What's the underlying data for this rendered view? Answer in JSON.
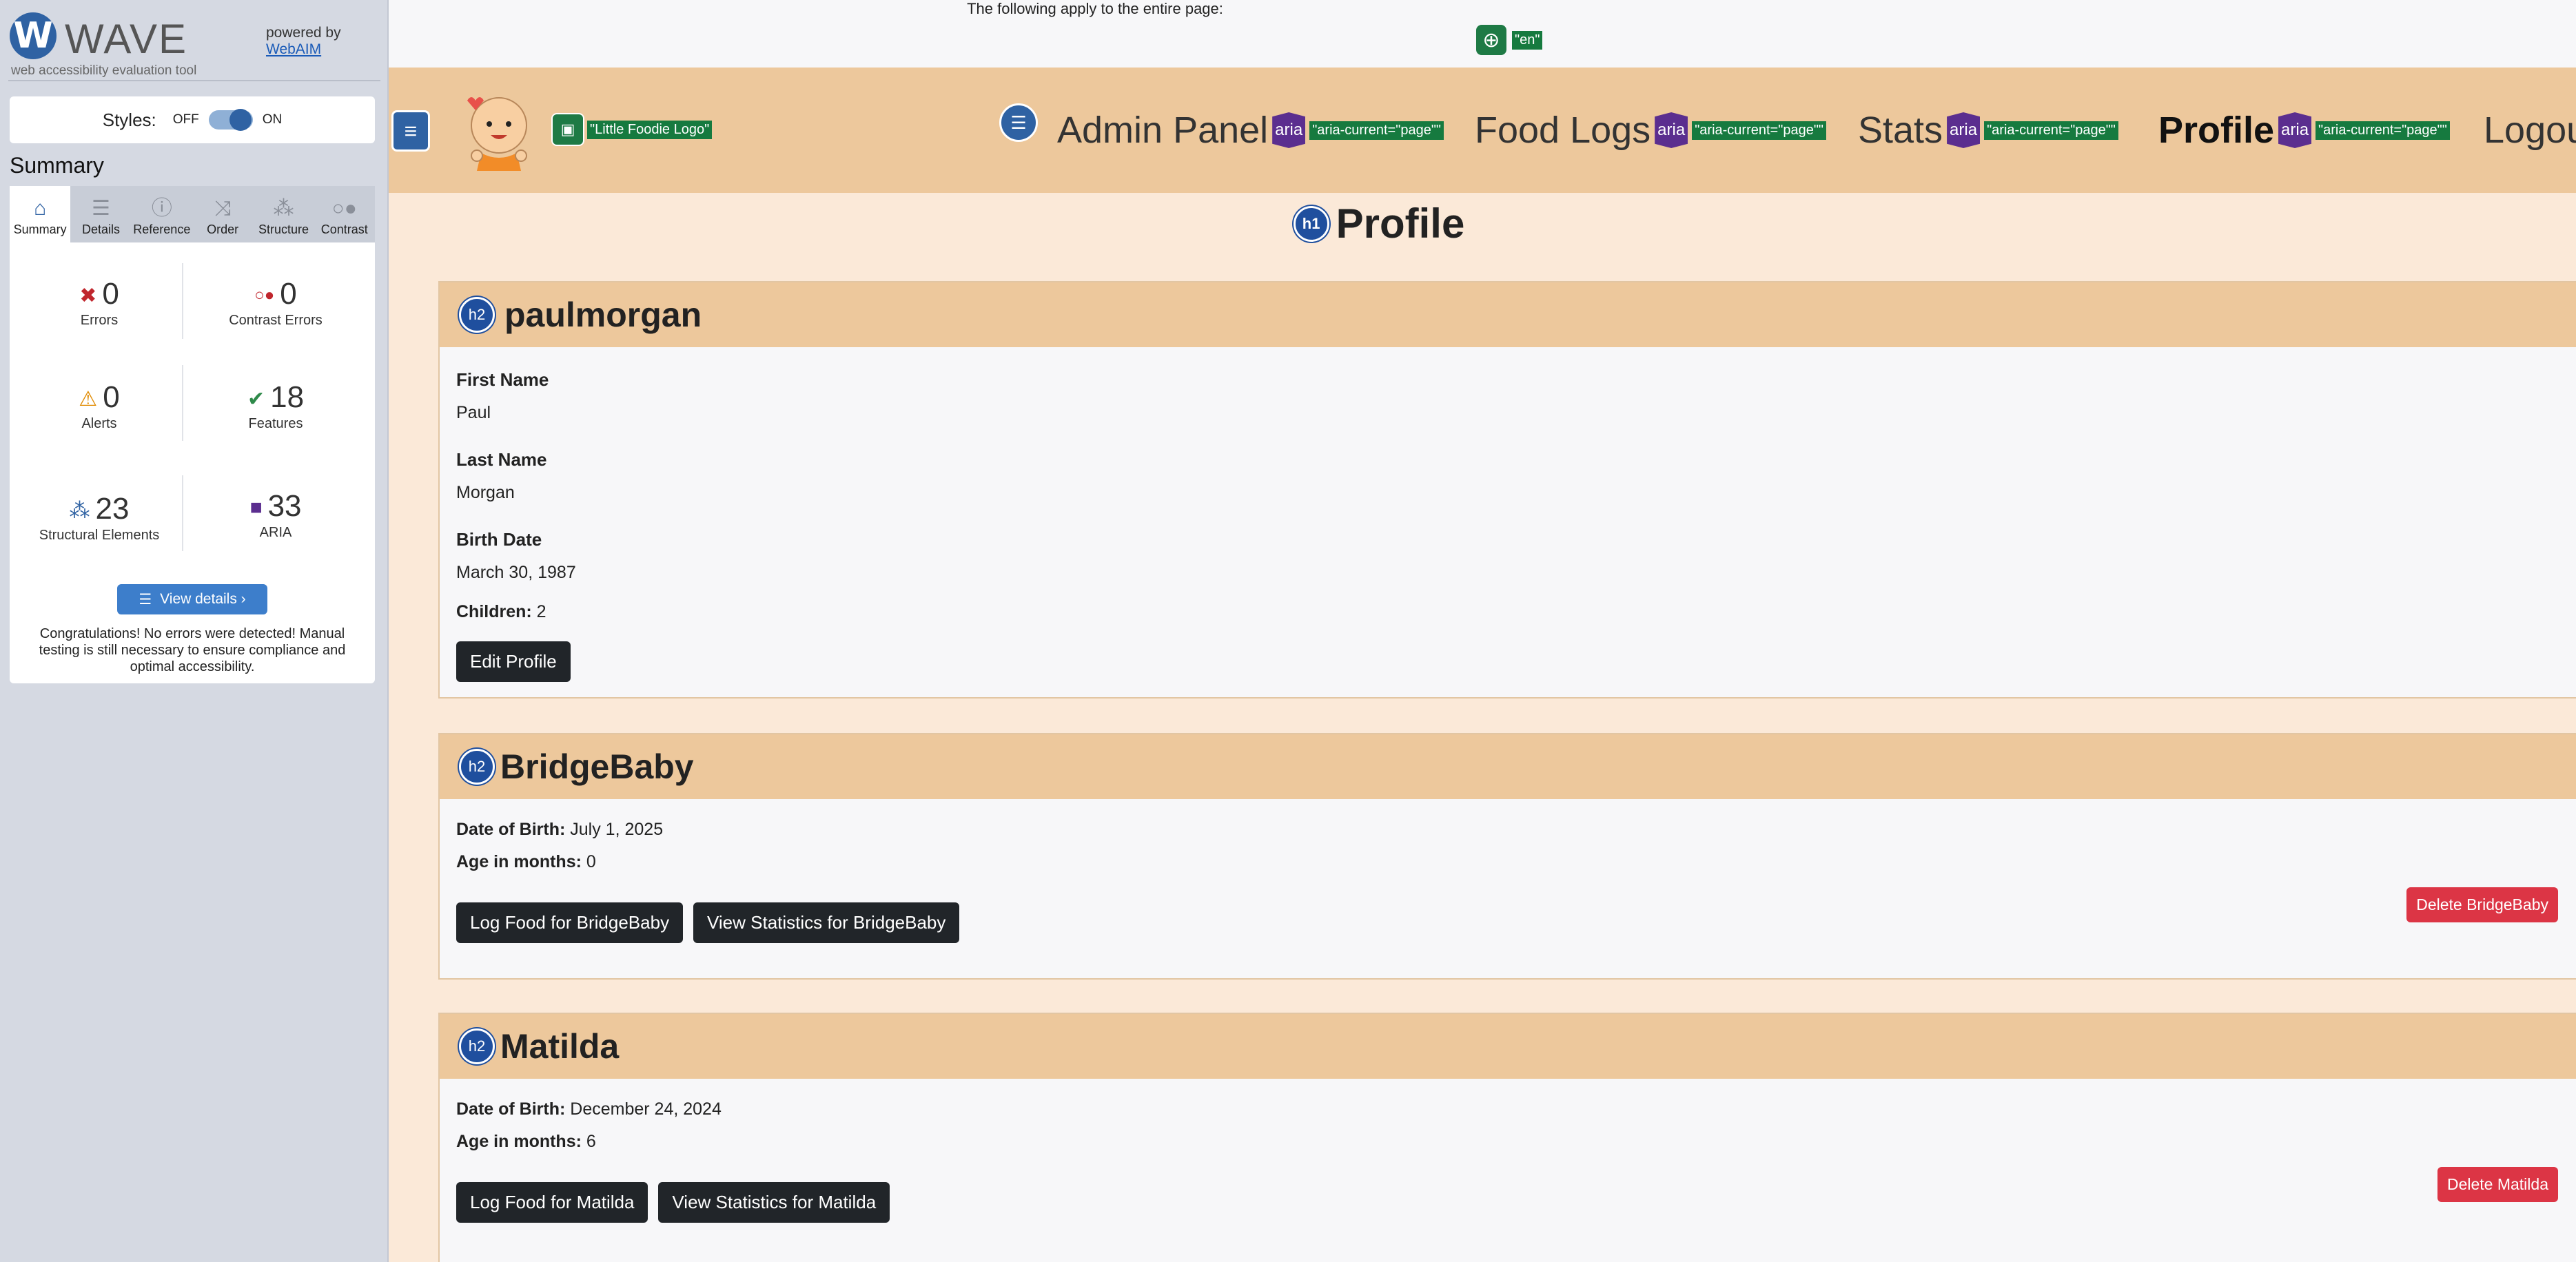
{
  "wave": {
    "logo_letter": "W",
    "logo_word": "WAVE",
    "tagline": "web accessibility evaluation tool",
    "powered_by": "powered by",
    "webaim_link": "WebAIM",
    "styles_label": "Styles:",
    "styles_off": "OFF",
    "styles_on": "ON",
    "summary_heading": "Summary",
    "tabs": [
      {
        "label": "Summary",
        "icon": "home-icon"
      },
      {
        "label": "Details",
        "icon": "list-icon"
      },
      {
        "label": "Reference",
        "icon": "info-icon"
      },
      {
        "label": "Order",
        "icon": "order-icon"
      },
      {
        "label": "Structure",
        "icon": "structure-icon"
      },
      {
        "label": "Contrast",
        "icon": "contrast-icon"
      }
    ],
    "stats": {
      "errors": {
        "value": "0",
        "label": "Errors"
      },
      "contrast_errors": {
        "value": "0",
        "label": "Contrast Errors"
      },
      "alerts": {
        "value": "0",
        "label": "Alerts"
      },
      "features": {
        "value": "18",
        "label": "Features"
      },
      "structural": {
        "value": "23",
        "label": "Structural Elements"
      },
      "aria": {
        "value": "33",
        "label": "ARIA"
      }
    },
    "view_details": "View details ›",
    "congrats": "Congratulations! No errors were detected! Manual testing is still necessary to ensure compliance and optimal accessibility.",
    "colors": {
      "brand": "#2f62a3",
      "error": "#c0262d",
      "alert": "#e08a00",
      "feature": "#2e8a4a",
      "aria": "#5b2e8f"
    }
  },
  "page": {
    "applies_text": "The following apply to the entire page:",
    "lang_tag": "\"en\"",
    "logo_alt_tag": "\"Little Foodie Logo\"",
    "nav": [
      {
        "label": "Admin Panel",
        "aria_tag": "\"aria-current=\"page\"\""
      },
      {
        "label": "Food Logs",
        "aria_tag": "\"aria-current=\"page\"\""
      },
      {
        "label": "Stats",
        "aria_tag": "\"aria-current=\"page\"\""
      },
      {
        "label": "Profile",
        "aria_tag": "\"aria-current=\"page\"\""
      },
      {
        "label": "Logou"
      }
    ],
    "aria_badge": "aria",
    "h1_badge": "h1",
    "h2_badge": "h2",
    "title": "Profile",
    "profile": {
      "username": "paulmorgan",
      "first_name_label": "First Name",
      "first_name": "Paul",
      "last_name_label": "Last Name",
      "last_name": "Morgan",
      "birth_date_label": "Birth Date",
      "birth_date": "March 30, 1987",
      "children_label": "Children:",
      "children": "2",
      "edit_button": "Edit Profile"
    },
    "children_cards": [
      {
        "name": "BridgeBaby",
        "dob_label": "Date of Birth:",
        "dob": "July 1, 2025",
        "age_label": "Age in months:",
        "age": "0",
        "log_button": "Log Food for BridgeBaby",
        "stats_button": "View Statistics for BridgeBaby",
        "delete_button": "Delete BridgeBaby"
      },
      {
        "name": "Matilda",
        "dob_label": "Date of Birth:",
        "dob": "December 24, 2024",
        "age_label": "Age in months:",
        "age": "6",
        "log_button": "Log Food for Matilda",
        "stats_button": "View Statistics for Matilda",
        "delete_button": "Delete Matilda"
      }
    ]
  }
}
